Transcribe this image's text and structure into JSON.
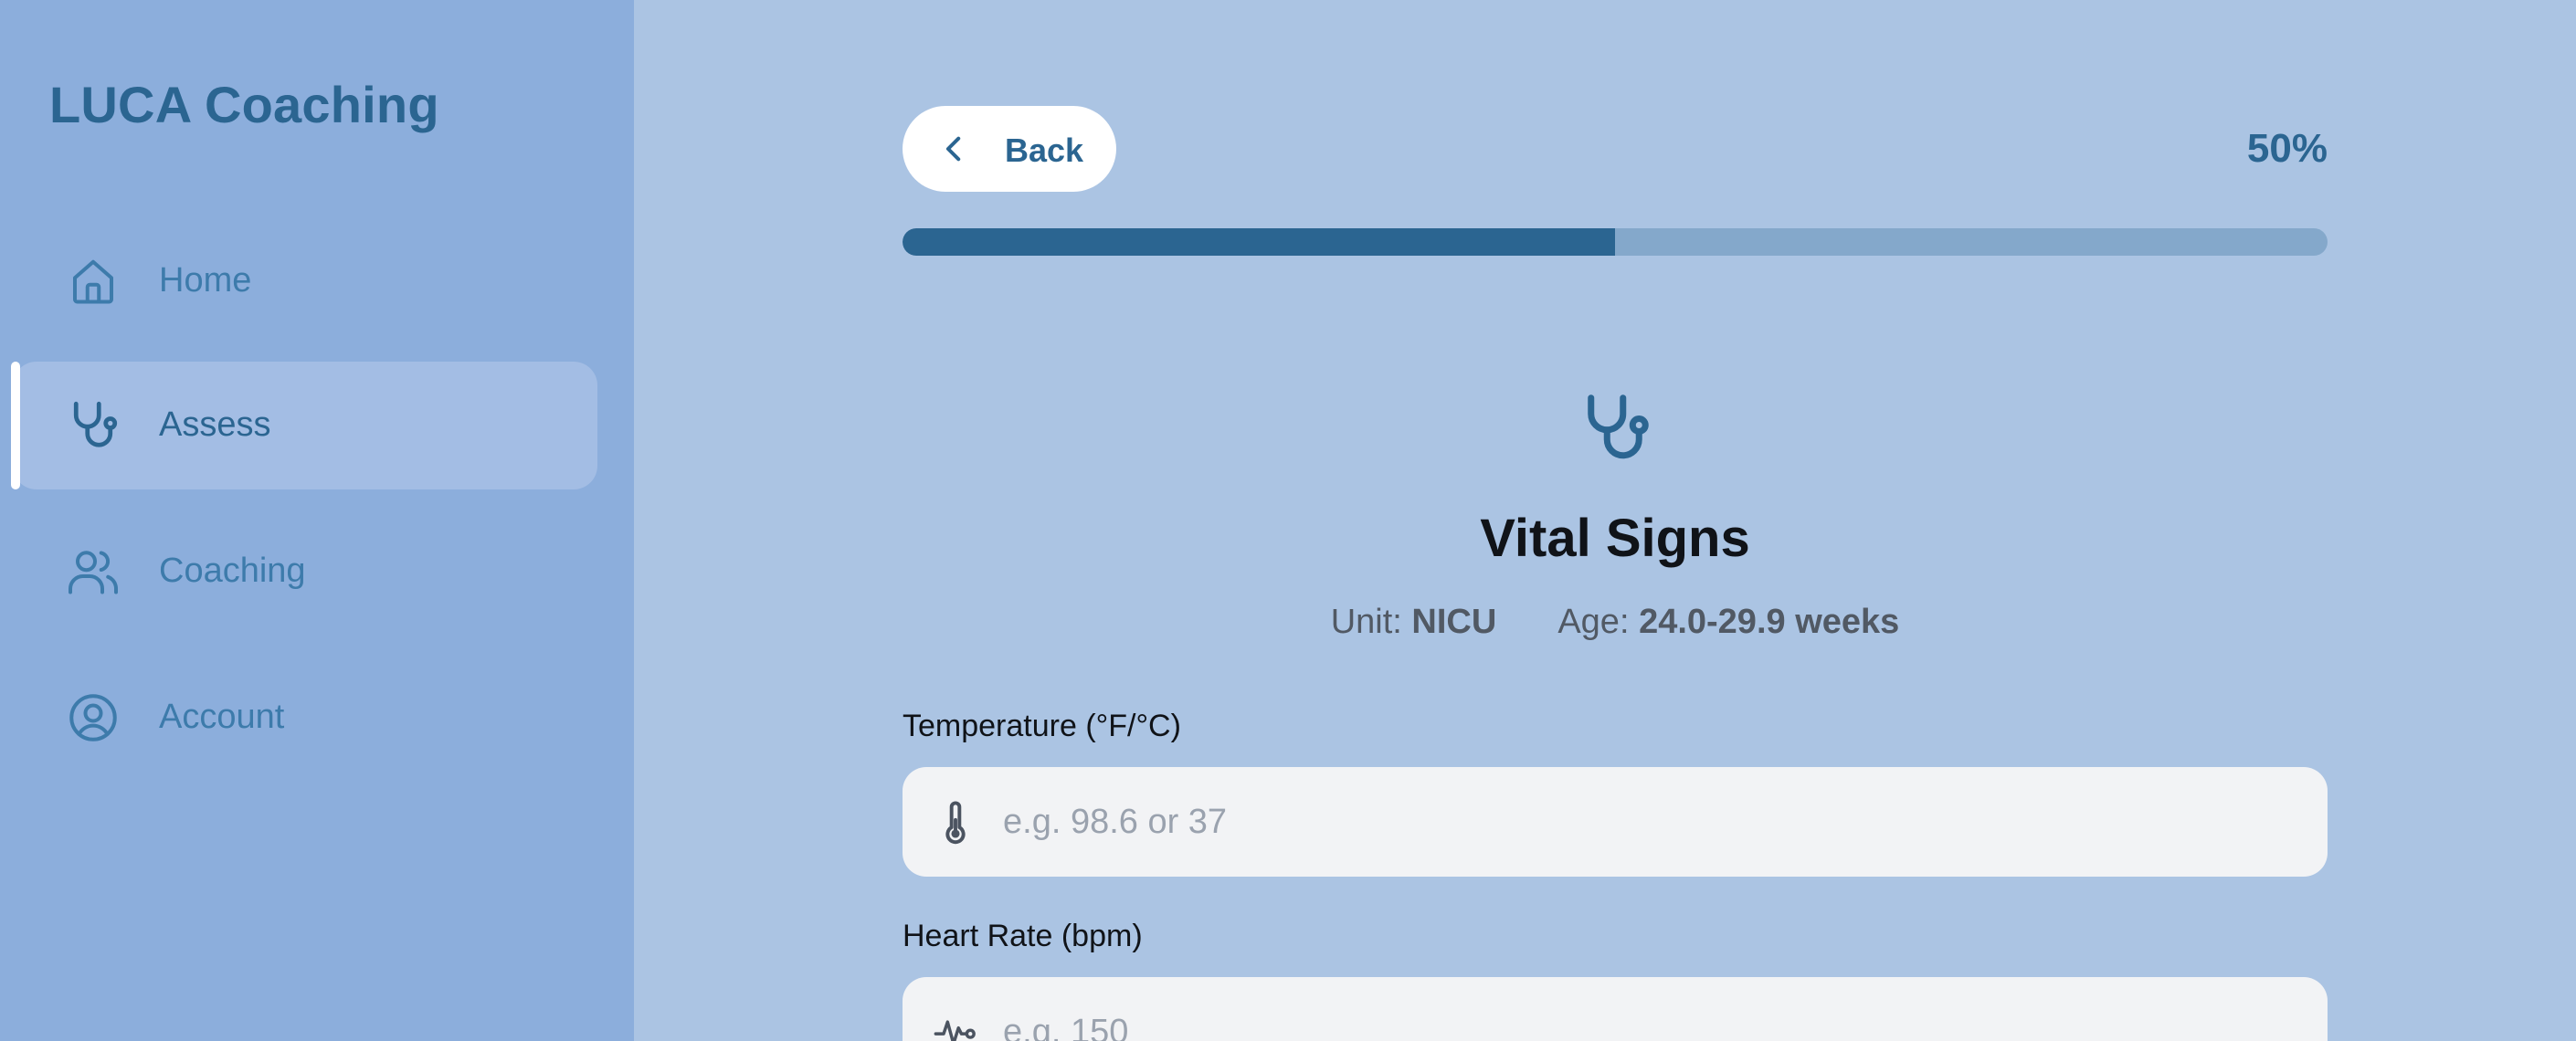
{
  "app": {
    "title": "LUCA Coaching"
  },
  "sidebar": {
    "items": [
      {
        "label": "Home",
        "icon": "home-icon",
        "active": false
      },
      {
        "label": "Assess",
        "icon": "stethoscope-icon",
        "active": true
      },
      {
        "label": "Coaching",
        "icon": "users-icon",
        "active": false
      },
      {
        "label": "Account",
        "icon": "user-circle-icon",
        "active": false
      }
    ]
  },
  "header": {
    "back_label": "Back",
    "progress_text": "50%",
    "progress_value": 0.5
  },
  "section": {
    "icon": "stethoscope-icon",
    "title": "Vital Signs",
    "unit_label": "Unit:",
    "unit_value": "NICU",
    "age_label": "Age:",
    "age_value": "24.0-29.9 weeks"
  },
  "fields": [
    {
      "label": "Temperature (°F/°C)",
      "placeholder": "e.g. 98.6 or 37",
      "icon": "thermometer-icon",
      "value": ""
    },
    {
      "label": "Heart Rate (bpm)",
      "placeholder": "e.g. 150",
      "icon": "heart-pulse-icon",
      "value": ""
    }
  ],
  "colors": {
    "accent": "#2b6591",
    "sidebar_bg": "#8caedc",
    "main_bg": "#abc4e3",
    "progress_track": "#84a8cb",
    "input_bg": "#f2f3f5"
  }
}
